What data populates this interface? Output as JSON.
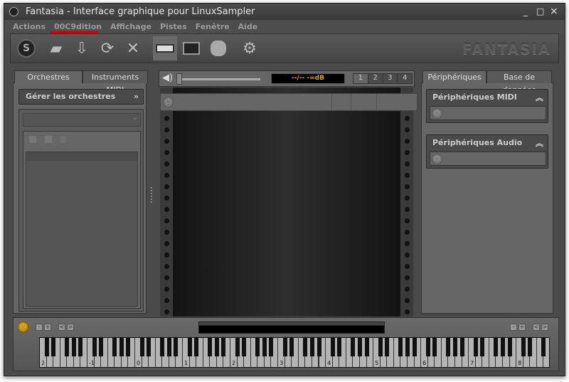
{
  "window": {
    "title": "Fantasia - Interface graphique pour LinuxSampler",
    "controls": [
      "_",
      "□",
      "×"
    ]
  },
  "menu": [
    "Actions",
    "00C9dition",
    "Affichage",
    "Pistes",
    "Fenêtre",
    "Aide"
  ],
  "toolbar": {
    "icons": [
      "sampler-icon",
      "open-folder-icon",
      "save-icon",
      "refresh-icon",
      "reset-icon",
      "keyboard-icon",
      "monitor-icon",
      "database-icon",
      "settings-icon"
    ],
    "logo": "FANTASIA"
  },
  "left": {
    "tabs": [
      "Orchestres",
      "Instruments MIDI"
    ],
    "header": "Gérer les orchestres"
  },
  "center": {
    "display": "--/--",
    "volume": "-∞dB",
    "pages": [
      "1",
      "2",
      "3",
      "4"
    ],
    "volume_level": 0
  },
  "right": {
    "tabs": [
      "Périphériques",
      "Base de données"
    ],
    "midi": "Périphériques MIDI",
    "audio": "Périphériques Audio"
  },
  "keyboard": {
    "octaves": [
      "2",
      "-1",
      "0",
      "1",
      "2",
      "3",
      "4",
      "5",
      "6",
      "7",
      "8"
    ],
    "buttons": [
      "-",
      "+",
      "<",
      ">"
    ]
  },
  "colors": {
    "accent": "#e8a000",
    "menu_underline": "#cc0000"
  }
}
